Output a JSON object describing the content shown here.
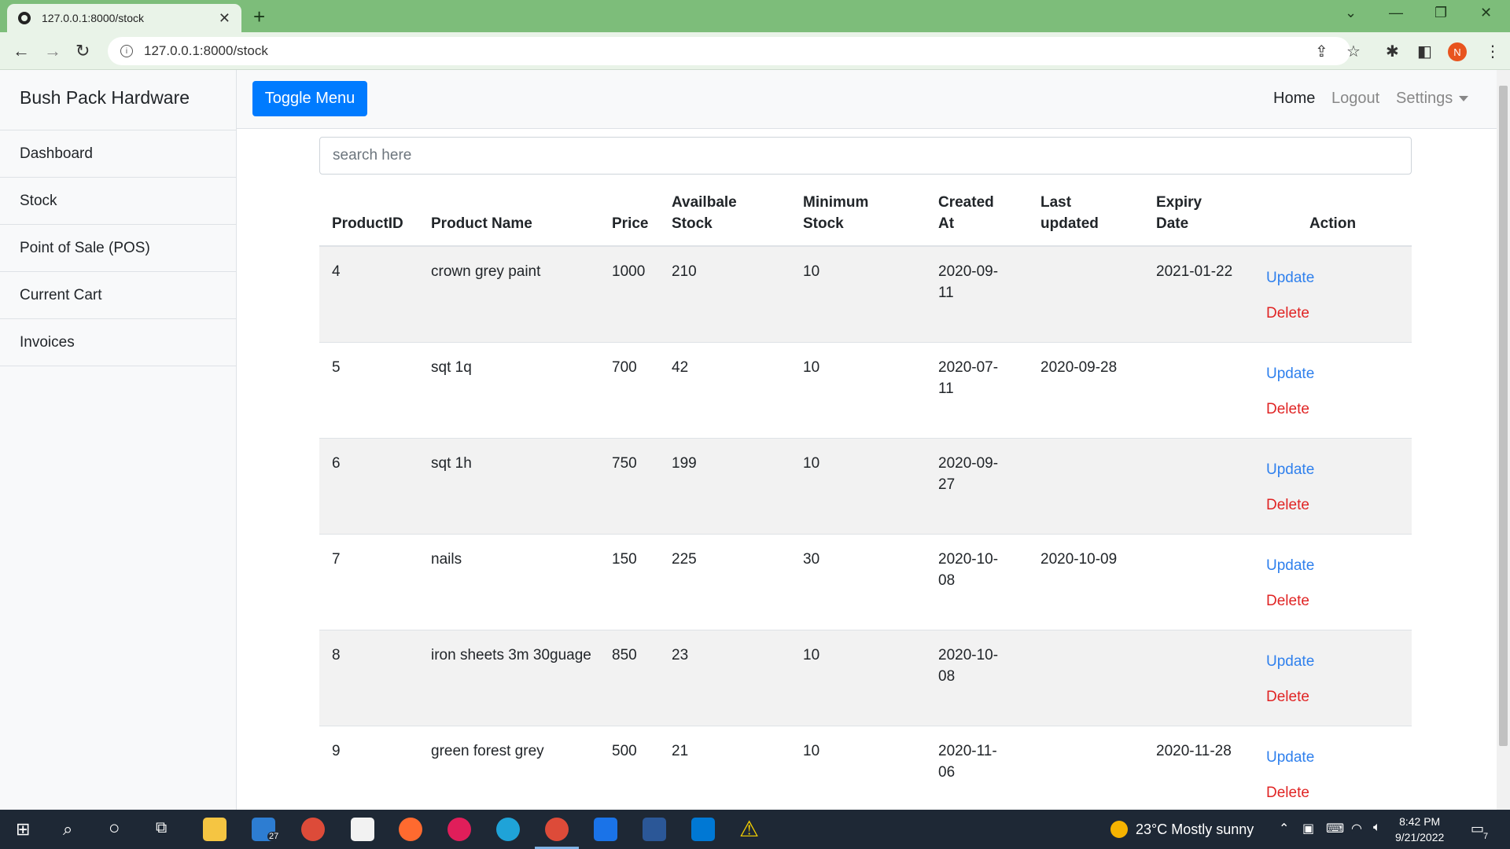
{
  "browser": {
    "tab_title": "127.0.0.1:8000/stock",
    "url": "127.0.0.1:8000/stock",
    "profile_initial": "N"
  },
  "sidebar": {
    "brand": "Bush Pack Hardware",
    "items": [
      {
        "label": "Dashboard"
      },
      {
        "label": "Stock"
      },
      {
        "label": "Point of Sale (POS)"
      },
      {
        "label": "Current Cart"
      },
      {
        "label": "Invoices"
      }
    ]
  },
  "topnav": {
    "toggle_label": "Toggle Menu",
    "home": "Home",
    "logout": "Logout",
    "settings": "Settings"
  },
  "search": {
    "placeholder": "search here"
  },
  "table": {
    "headers": {
      "id": "ProductID",
      "name": "Product Name",
      "price": "Price",
      "avail_1": "Availbale",
      "avail_2": "Stock",
      "min_1": "Minimum",
      "min_2": "Stock",
      "created_1": "Created",
      "created_2": "At",
      "last_1": "Last",
      "last_2": "updated",
      "expiry_1": "Expiry",
      "expiry_2": "Date",
      "action": "Action"
    },
    "update_label": "Update",
    "delete_label": "Delete",
    "rows": [
      {
        "id": "4",
        "name": "crown grey paint",
        "price": "1000",
        "available": "210",
        "minimum": "10",
        "created_1": "2020-09-",
        "created_2": "11",
        "last_updated": "",
        "expiry": "2021-01-22"
      },
      {
        "id": "5",
        "name": "sqt 1q",
        "price": "700",
        "available": "42",
        "minimum": "10",
        "created_1": "2020-07-",
        "created_2": "11",
        "last_updated": "2020-09-28",
        "expiry": ""
      },
      {
        "id": "6",
        "name": "sqt 1h",
        "price": "750",
        "available": "199",
        "minimum": "10",
        "created_1": "2020-09-",
        "created_2": "27",
        "last_updated": "",
        "expiry": ""
      },
      {
        "id": "7",
        "name": "nails",
        "price": "150",
        "available": "225",
        "minimum": "30",
        "created_1": "2020-10-",
        "created_2": "08",
        "last_updated": "2020-10-09",
        "expiry": ""
      },
      {
        "id": "8",
        "name": "iron sheets 3m 30guage",
        "price": "850",
        "available": "23",
        "minimum": "10",
        "created_1": "2020-10-",
        "created_2": "08",
        "last_updated": "",
        "expiry": ""
      },
      {
        "id": "9",
        "name": "green forest grey",
        "price": "500",
        "available": "21",
        "minimum": "10",
        "created_1": "2020-11-",
        "created_2": "06",
        "last_updated": "",
        "expiry": "2020-11-28"
      }
    ]
  },
  "taskbar": {
    "mail_badge": "27",
    "weather": "23°C  Mostly sunny",
    "time": "8:42 PM",
    "date": "9/21/2022",
    "notif_count": "7"
  },
  "colors": {
    "primary": "#007bff",
    "link_update": "#2f80ed",
    "link_delete": "#e02424",
    "chrome_green": "#7dbd7a"
  }
}
